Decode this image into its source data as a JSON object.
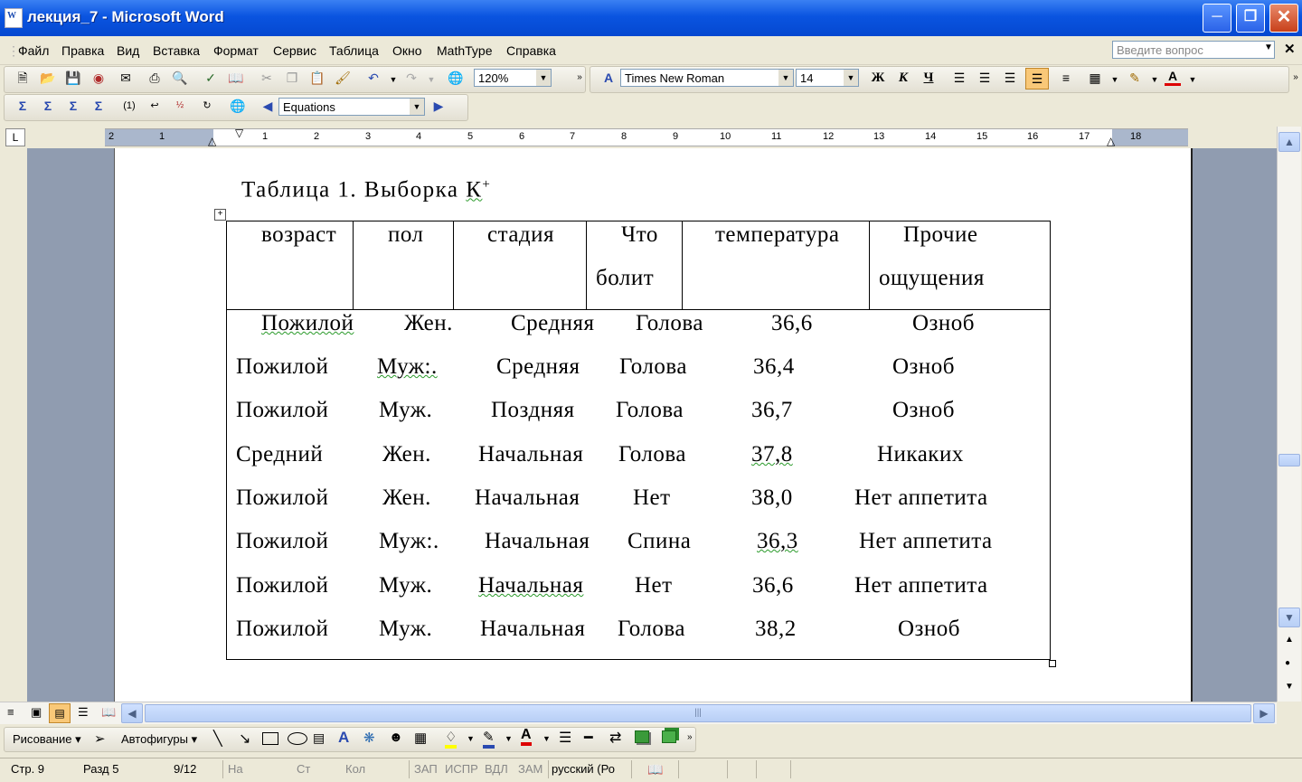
{
  "window": {
    "title": "лекция_7 - Microsoft Word"
  },
  "menu": [
    "Файл",
    "Правка",
    "Вид",
    "Вставка",
    "Формат",
    "Сервис",
    "Таблица",
    "Окно",
    "MathType",
    "Справка"
  ],
  "ask_placeholder": "Введите вопрос",
  "toolbar": {
    "zoom": "120%",
    "font": "Times New Roman",
    "size": "14",
    "style": "Equations"
  },
  "ruler": [
    "2",
    "1",
    "1",
    "2",
    "3",
    "4",
    "5",
    "6",
    "7",
    "8",
    "9",
    "10",
    "11",
    "12",
    "13",
    "14",
    "15",
    "16",
    "17",
    "18"
  ],
  "doc": {
    "caption_prefix": "Таблица 1. Выборка ",
    "caption_k": "К",
    "caption_sup": "+",
    "headers": {
      "age": "возраст",
      "sex": "пол",
      "stage": "стадия",
      "pain_1": "Что",
      "pain_2": "болит",
      "temp": "температура",
      "other_1": "Прочие",
      "other_2": "ощущения"
    },
    "rows": [
      [
        "Пожилой",
        "Жен.",
        "Средняя",
        "Голова",
        "36,6",
        "Озноб"
      ],
      [
        "Пожилой",
        "Муж:.",
        "Средняя",
        "Голова",
        "36,4",
        "Озноб"
      ],
      [
        "Пожилой",
        "Муж.",
        "Поздняя",
        "Голова",
        "36,7",
        "Озноб"
      ],
      [
        "Средний",
        "Жен.",
        "Начальная",
        "Голова",
        "37,8",
        "Никаких"
      ],
      [
        "Пожилой",
        "Жен.",
        "Начальная",
        "Нет",
        "38,0",
        "Нет аппетита"
      ],
      [
        "Пожилой",
        "Муж:.",
        "Начальная",
        "Спина",
        "36,3",
        "Нет аппетита"
      ],
      [
        "Пожилой",
        "Муж.",
        "Начальная",
        "Нет",
        "36,6",
        "Нет аппетита"
      ],
      [
        "Пожилой",
        "Муж.",
        "Начальная",
        "Голова",
        "38,2",
        "Озноб"
      ]
    ]
  },
  "drawing": {
    "draw_label": "Рисование",
    "autoshapes_label": "Автофигуры"
  },
  "status": {
    "page": "Стр. 9",
    "section": "Разд 5",
    "pages": "9/12",
    "at": "На",
    "line": "Ст",
    "col": "Кол",
    "rec": "ЗАП",
    "trk": "ИСПР",
    "ext": "ВДЛ",
    "ovr": "ЗАМ",
    "lang": "русский (Ро"
  }
}
